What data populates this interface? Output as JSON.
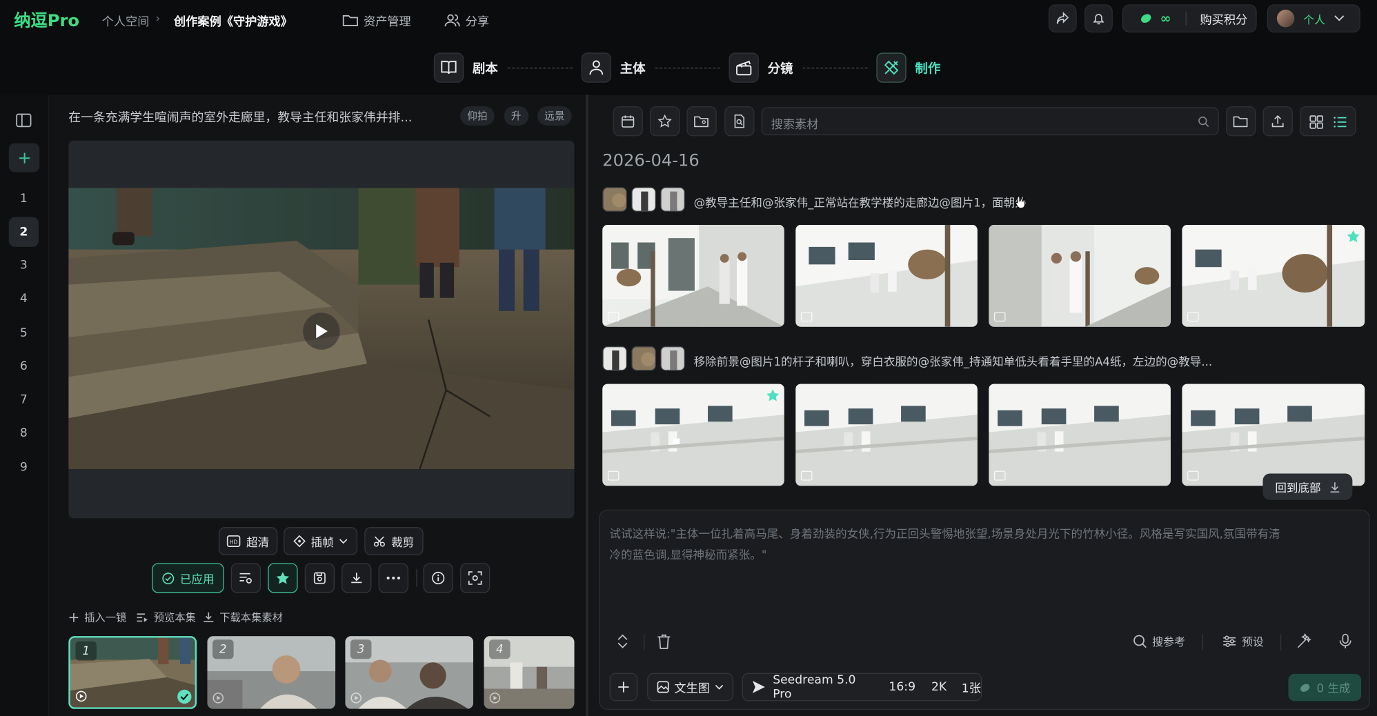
{
  "app": {
    "logo": "纳逗Pro"
  },
  "breadcrumb": {
    "root": "个人空间",
    "separator": "›",
    "current": "创作案例《守护游戏》"
  },
  "topnav": {
    "assets": "资产管理",
    "share": "分享"
  },
  "credits": {
    "value": "∞",
    "buy": "购买积分"
  },
  "user": {
    "label": "个人"
  },
  "steps": [
    {
      "label": "剧本"
    },
    {
      "label": "主体"
    },
    {
      "label": "分镜"
    },
    {
      "label": "制作"
    }
  ],
  "shots": [
    "1",
    "2",
    "3",
    "4",
    "5",
    "6",
    "7",
    "8",
    "9"
  ],
  "active_shot": "2",
  "scene": {
    "description": "在一条充满学生喧闹声的室外走廊里，教导主任和张家伟并排...",
    "tags": [
      "仰拍",
      "升",
      "远景"
    ]
  },
  "video_toolbar": {
    "hd": "超清",
    "interp": "插帧",
    "crop": "裁剪",
    "applied": "已应用"
  },
  "episode_actions": {
    "insert": "插入一镜",
    "preview": "预览本集",
    "download": "下载本集素材"
  },
  "thumbs": [
    "1",
    "2",
    "3",
    "4"
  ],
  "search": {
    "placeholder": "搜索素材"
  },
  "gallery": {
    "date": "2026-04-16",
    "groups": [
      {
        "prompt": "@教导主任和@张家伟_正常站在教学楼的走廊边@图片1，面朝外"
      },
      {
        "prompt": "移除前景@图片1的杆子和喇叭，穿白衣服的@张家伟_持通知单低头看着手里的A4纸，左边的@教导..."
      }
    ],
    "back_to_bottom": "回到底部"
  },
  "composer": {
    "placeholder_line1": "试试这样说:\"主体一位扎着高马尾、身着劲装的女侠,行为正回头警惕地张望,场景身处月光下的竹林小径。风格是写实国风,氛围带有清",
    "placeholder_line2": "冷的蓝色调,显得神秘而紧张。\"",
    "search_ref": "搜参考",
    "preset": "预设",
    "mode": "文生图",
    "model": "Seedream 5.0 Pro",
    "ratio": "16:9",
    "resolution": "2K",
    "count": "1张",
    "generate": "0 生成"
  },
  "colors": {
    "accent": "#3ddc84",
    "teal": "#3ec29a",
    "star": "#4fe0c0"
  }
}
